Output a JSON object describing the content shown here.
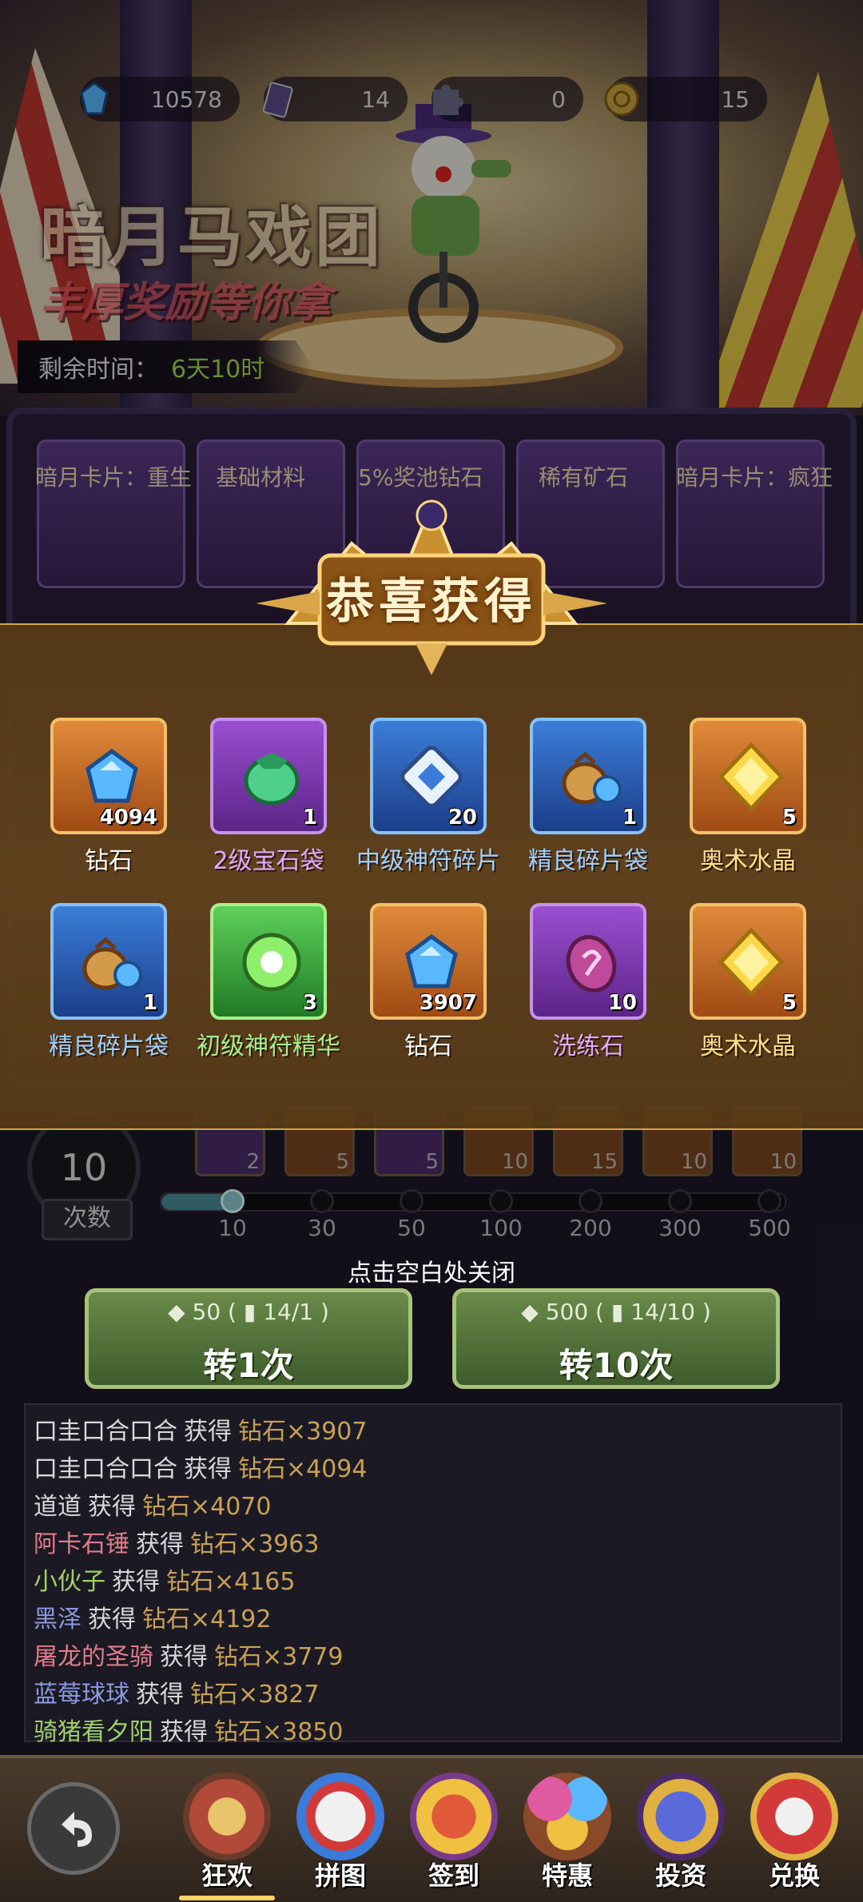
{
  "currency": {
    "diamond": "10578",
    "ticket": "14",
    "puzzle": "0",
    "coin": "15"
  },
  "event": {
    "title": "暗月马戏团",
    "subtitle": "丰厚奖励等你拿",
    "time_label": "剩余时间：",
    "time_value": "6天10时"
  },
  "board_labels": [
    "暗月卡片：重生",
    "基础材料",
    "5%奖池钻石",
    "稀有矿石",
    "暗月卡片：疯狂"
  ],
  "popup": {
    "title": "恭喜获得",
    "rewards": [
      {
        "name": "钻石",
        "count": "4094",
        "rarity": "orange",
        "icon": "diamond-icon",
        "name_color": "#ffffff"
      },
      {
        "name": "2级宝石袋",
        "count": "1",
        "rarity": "purple",
        "icon": "gem-bag-icon",
        "name_color": "#e2a8ff"
      },
      {
        "name": "中级神符碎片",
        "count": "20",
        "rarity": "blue",
        "icon": "rune-shard-icon",
        "name_color": "#9fd0ff"
      },
      {
        "name": "精良碎片袋",
        "count": "1",
        "rarity": "blue",
        "icon": "shard-bag-icon",
        "name_color": "#9fd0ff"
      },
      {
        "name": "奥术水晶",
        "count": "5",
        "rarity": "orange",
        "icon": "arcane-crystal-icon",
        "name_color": "#ffe08a"
      },
      {
        "name": "精良碎片袋",
        "count": "1",
        "rarity": "blue",
        "icon": "shard-bag-icon",
        "name_color": "#9fd0ff"
      },
      {
        "name": "初级神符精华",
        "count": "3",
        "rarity": "green",
        "icon": "rune-essence-icon",
        "name_color": "#a8f08c"
      },
      {
        "name": "钻石",
        "count": "3907",
        "rarity": "orange",
        "icon": "diamond-icon",
        "name_color": "#ffffff"
      },
      {
        "name": "洗练石",
        "count": "10",
        "rarity": "purple",
        "icon": "refine-stone-icon",
        "name_color": "#e2a8ff"
      },
      {
        "name": "奥术水晶",
        "count": "5",
        "rarity": "orange",
        "icon": "arcane-crystal-icon",
        "name_color": "#ffe08a"
      }
    ]
  },
  "spin_count": {
    "value": "10",
    "label": "次数"
  },
  "mini_rewards": [
    {
      "count": "2",
      "rarity": "purple"
    },
    {
      "count": "5",
      "rarity": "orange"
    },
    {
      "count": "5",
      "rarity": "purple"
    },
    {
      "count": "10",
      "rarity": "orange"
    },
    {
      "count": "15",
      "rarity": "orange"
    },
    {
      "count": "10",
      "rarity": "orange"
    },
    {
      "count": "10",
      "rarity": "orange"
    }
  ],
  "slider": {
    "ticks": [
      "10",
      "30",
      "50",
      "100",
      "200",
      "300",
      "500"
    ],
    "selected": "10"
  },
  "close_hint": "点击空白处关闭",
  "spin_buttons": [
    {
      "cost_diamond": "50",
      "cost_ticket": "14/1",
      "label": "转1次"
    },
    {
      "cost_diamond": "500",
      "cost_ticket": "14/10",
      "label": "转10次"
    }
  ],
  "log": [
    {
      "user": "口圭口合口合",
      "user_color": "#d8d8d8",
      "action": "获得",
      "item": "钻石×3907"
    },
    {
      "user": "口圭口合口合",
      "user_color": "#d8d8d8",
      "action": "获得",
      "item": "钻石×4094"
    },
    {
      "user": "道道",
      "user_color": "#d8d8d8",
      "action": "获得",
      "item": "钻石×4070"
    },
    {
      "user": "阿卡石锤",
      "user_color": "#e07c8a",
      "action": "获得",
      "item": "钻石×3963"
    },
    {
      "user": "小伙子",
      "user_color": "#9fd06a",
      "action": "获得",
      "item": "钻石×4165"
    },
    {
      "user": "黑泽",
      "user_color": "#8a9ae0",
      "action": "获得",
      "item": "钻石×4192"
    },
    {
      "user": "屠龙的圣骑",
      "user_color": "#e07c8a",
      "action": "获得",
      "item": "钻石×3779"
    },
    {
      "user": "蓝莓球球",
      "user_color": "#8a9ae0",
      "action": "获得",
      "item": "钻石×3827"
    },
    {
      "user": "骑猪看夕阳",
      "user_color": "#9fd06a",
      "action": "获得",
      "item": "钻石×3850"
    }
  ],
  "nav": [
    {
      "label": "狂欢",
      "icon": "ferris-wheel-icon",
      "active": true
    },
    {
      "label": "拼图",
      "icon": "clown-face-icon",
      "active": false
    },
    {
      "label": "签到",
      "icon": "jack-in-box-icon",
      "active": false
    },
    {
      "label": "特惠",
      "icon": "balloons-icon",
      "active": false
    },
    {
      "label": "投资",
      "icon": "jester-cards-icon",
      "active": false
    },
    {
      "label": "兑换",
      "icon": "clown-tent-icon",
      "active": false
    }
  ]
}
